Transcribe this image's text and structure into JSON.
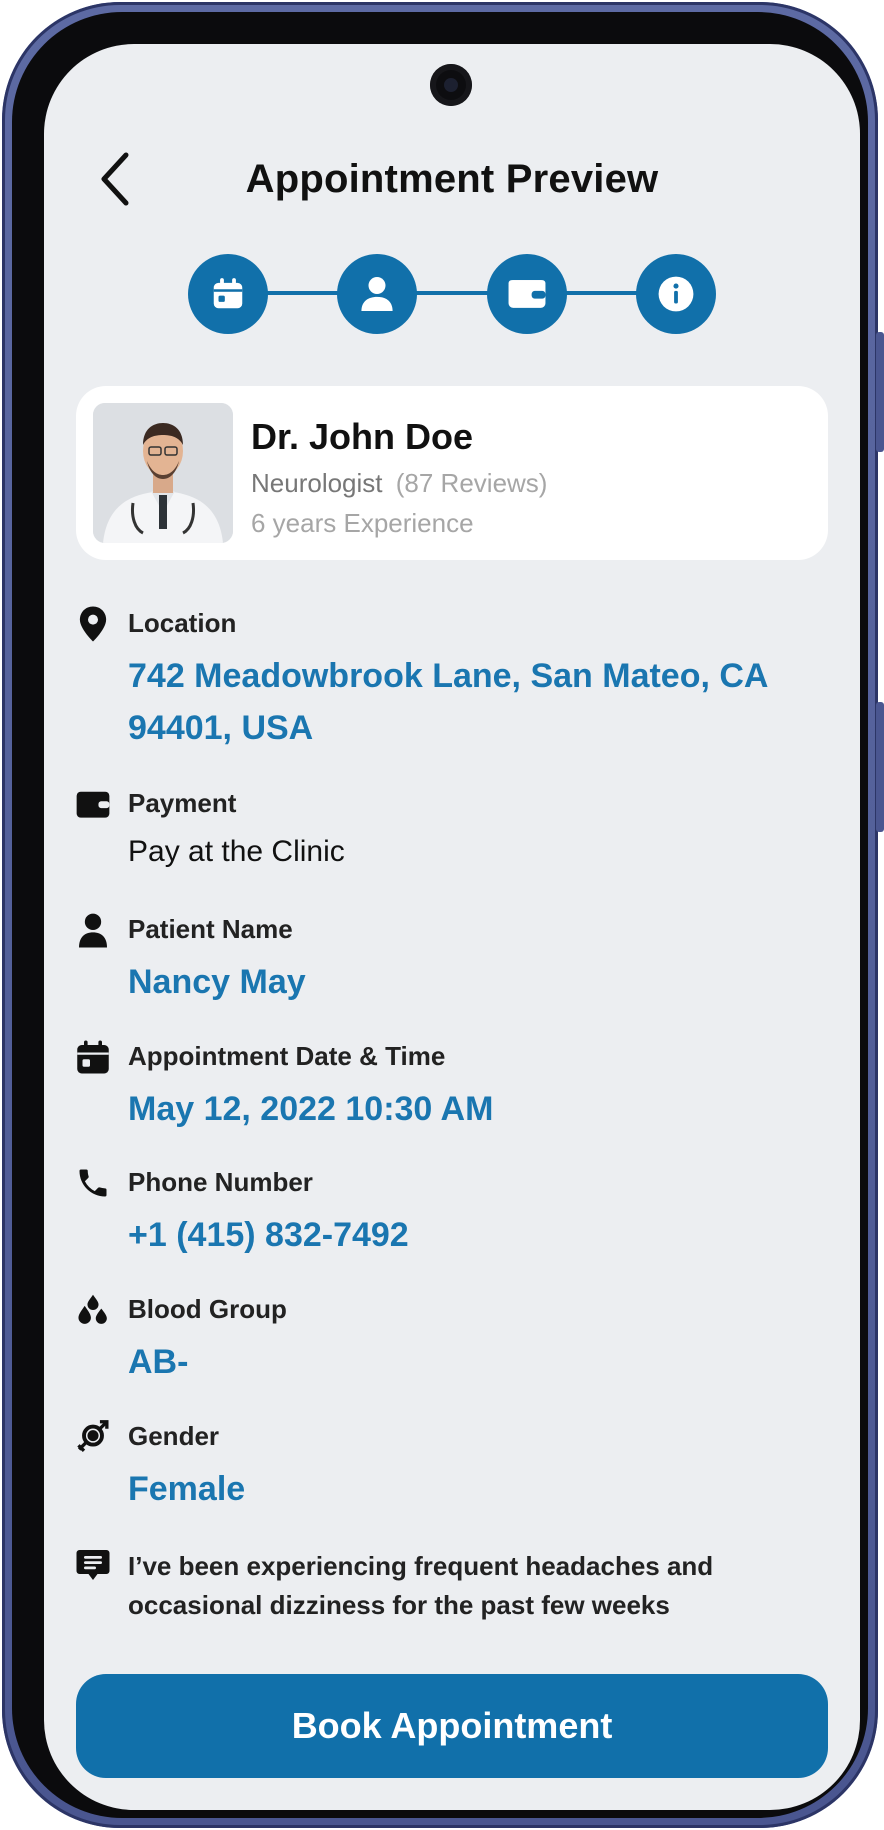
{
  "header": {
    "title": "Appointment Preview"
  },
  "stepper": {
    "steps": [
      {
        "icon": "calendar-icon"
      },
      {
        "icon": "user-icon"
      },
      {
        "icon": "wallet-icon"
      },
      {
        "icon": "info-icon"
      }
    ],
    "active_color": "#1170aa"
  },
  "doctor": {
    "name": "Dr. John Doe",
    "specialty": "Neurologist",
    "reviews": "(87 Reviews)",
    "experience": "6 years Experience"
  },
  "details": {
    "location": {
      "label": "Location",
      "value": "742 Meadowbrook Lane, San Mateo, CA 94401, USA"
    },
    "payment": {
      "label": "Payment",
      "value": "Pay at the Clinic"
    },
    "patient": {
      "label": "Patient Name",
      "value": "Nancy May"
    },
    "datetime": {
      "label": "Appointment Date & Time",
      "value": "May 12, 2022 10:30 AM"
    },
    "phone": {
      "label": "Phone Number",
      "value": "+1 (415) 832-7492"
    },
    "blood": {
      "label": "Blood Group",
      "value": "AB-"
    },
    "gender": {
      "label": "Gender",
      "value": "Female"
    },
    "note": " I’ve been experiencing frequent headaches and occasional dizziness for the past few weeks"
  },
  "actions": {
    "book_label": "Book Appointment"
  },
  "colors": {
    "primary": "#1170aa",
    "screen_bg": "#eceef1",
    "value_text": "#1a76b0"
  }
}
